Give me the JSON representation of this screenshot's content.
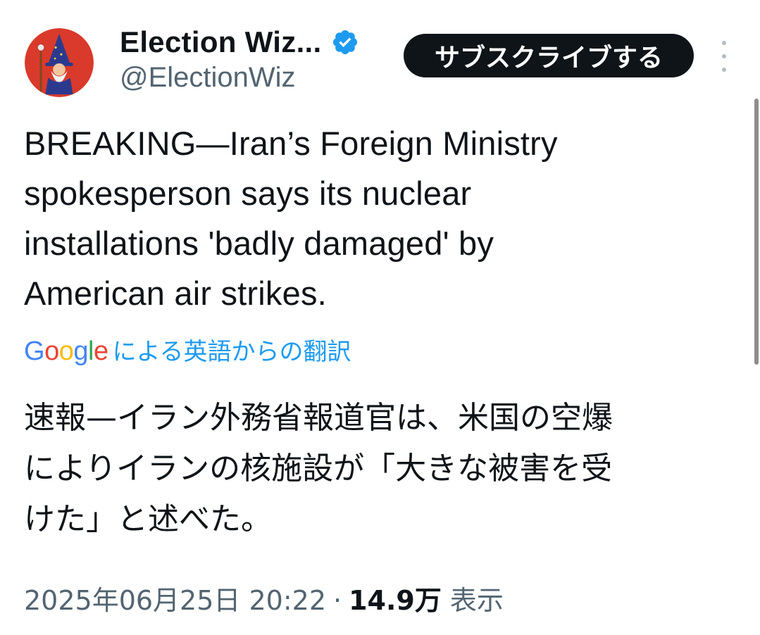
{
  "author": {
    "name": "Election Wiz...",
    "handle": "@ElectionWiz",
    "verified": true,
    "avatar_icon": "wizard-avatar-icon"
  },
  "header": {
    "subscribe_label": "サブスクライブする",
    "more_icon": "more-vertical-icon"
  },
  "tweet": {
    "text": "BREAKING—Iran’s Foreign Ministry\nspokesperson says its nuclear\ninstallations 'badly damaged' by\nAmerican air strikes."
  },
  "translation": {
    "provider": "Google",
    "label": "による英語からの翻訳",
    "text": "速報—イラン外務省報道官は、米国の空爆\nによりイランの核施設が「大きな被害を受\nけた」と述べた。"
  },
  "meta": {
    "timestamp": "2025年06月25日 20:22",
    "separator": "·",
    "views": "14.9万",
    "views_label": "表示"
  },
  "colors": {
    "text": "#0f1419",
    "secondary": "#536471",
    "link": "#1d9bf0",
    "verified": "#1d9bf0",
    "button_bg": "#0f1419",
    "avatar_bg": "#d93a2b"
  }
}
